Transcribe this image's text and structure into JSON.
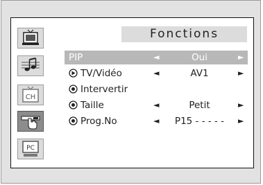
{
  "menu": {
    "title": "Fonctions"
  },
  "sidebar": {
    "items": [
      {
        "icon": "picture-tv-icon",
        "active": false
      },
      {
        "icon": "sound-note-icon",
        "active": false
      },
      {
        "icon": "channel-tv-icon",
        "label": "CH",
        "active": false
      },
      {
        "icon": "function-pip-hand-icon",
        "active": true
      },
      {
        "icon": "pc-monitor-icon",
        "label": "PC",
        "active": false
      }
    ]
  },
  "rows": [
    {
      "label": "PIP",
      "value": "Oui",
      "selected": true,
      "arrow_left": "◄",
      "arrow_right": "►"
    },
    {
      "label": "TV/Vidéo",
      "value": "AV1",
      "arrow_left": "◄",
      "arrow_right": "►"
    },
    {
      "label": "Intervertir",
      "value": "",
      "arrow_left": "",
      "arrow_right": ""
    },
    {
      "label": "Taille",
      "value": "Petit",
      "arrow_left": "◄",
      "arrow_right": "►"
    },
    {
      "label": "Prog.No",
      "value": "P15 - - - - -",
      "arrow_left": "◄",
      "arrow_right": "►"
    }
  ]
}
